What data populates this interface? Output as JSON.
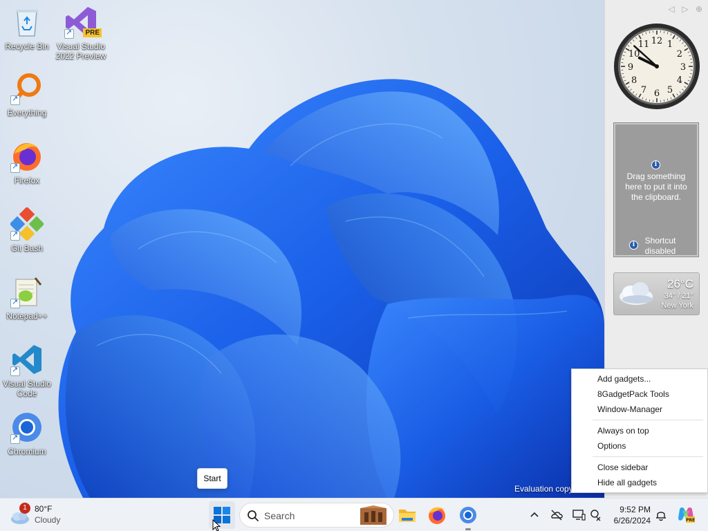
{
  "desktop": {
    "icons": [
      {
        "label": "Recycle Bin",
        "icon": "recycle-bin-icon"
      },
      {
        "label": "Visual Studio 2022 Preview",
        "icon": "visual-studio-preview-icon",
        "badge": "PRE"
      },
      {
        "label": "Everything",
        "icon": "everything-search-icon"
      },
      {
        "label": "Firefox",
        "icon": "firefox-icon"
      },
      {
        "label": "Git Bash",
        "icon": "git-bash-icon"
      },
      {
        "label": "Notepad++",
        "icon": "notepad-plus-plus-icon"
      },
      {
        "label": "Visual Studio Code",
        "icon": "vscode-icon"
      },
      {
        "label": "Chromium",
        "icon": "chromium-icon"
      }
    ],
    "watermark": "Evaluation copy",
    "start_tooltip": "Start"
  },
  "sidebar": {
    "nav": {
      "prev": "◁",
      "next": "▷",
      "add": "⊕"
    },
    "clock": {
      "numerals": [
        "12",
        "1",
        "2",
        "3",
        "4",
        "5",
        "6",
        "7",
        "8",
        "9",
        "10",
        "11"
      ],
      "hour": 9,
      "minute": 52
    },
    "clipboard": {
      "message": "Drag something here to put it into the clipboard.",
      "shortcut": "Shortcut disabled"
    },
    "weather": {
      "temp": "26°C",
      "range": "34° / 21°",
      "city": "New York"
    }
  },
  "context_menu": {
    "groups": [
      [
        "Add gadgets...",
        "8GadgetPack Tools",
        "Window-Manager"
      ],
      [
        "Always on top",
        "Options"
      ],
      [
        "Close sidebar",
        "Hide all gadgets"
      ]
    ]
  },
  "taskbar": {
    "weather": {
      "temp": "80°F",
      "condition": "Cloudy",
      "badge": "1"
    },
    "search_placeholder": "Search",
    "apps": [
      "file-explorer-icon",
      "firefox-icon",
      "chromium-icon"
    ],
    "tray": [
      "chevron-up-icon",
      "onedrive-offline-icon",
      "display-icon",
      "network-icon"
    ],
    "time": "9:52 PM",
    "date": "6/26/2024",
    "colors": {
      "accent": "#0067c0",
      "badge": "#c42b1c"
    }
  }
}
